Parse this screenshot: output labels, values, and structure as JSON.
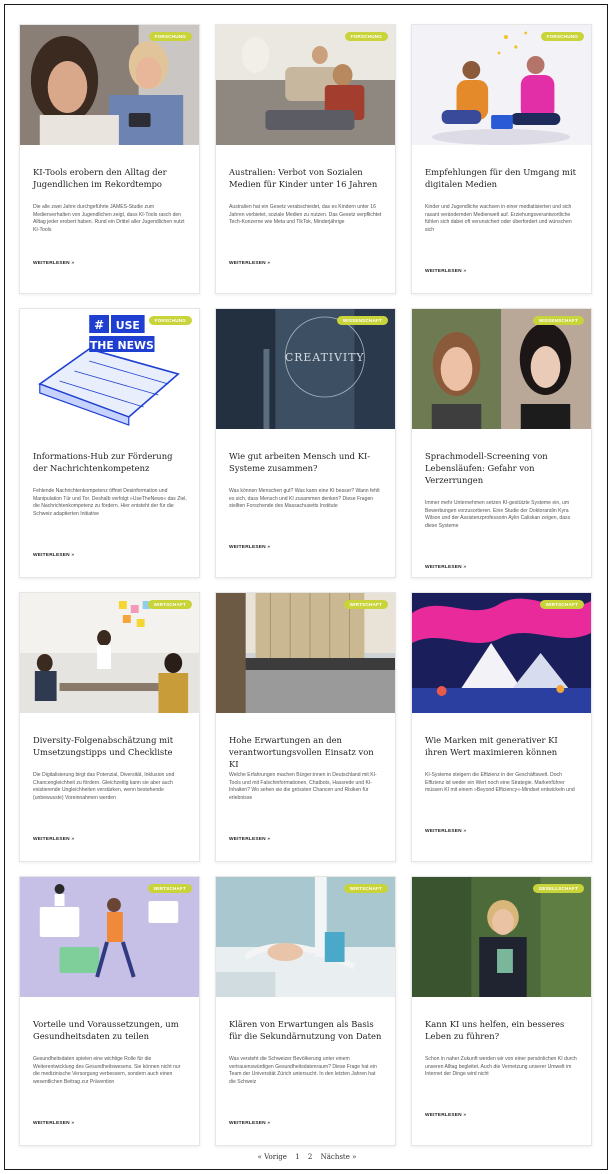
{
  "cards": [
    {
      "badge": "Forschung",
      "title": "KI-Tools erobern den Alltag der Jugendlichen im Rekordtempo",
      "excerpt": "Die alle zwei Jahre durchgeführte JAMES-Studie zum Medienverhalten von Jugendlichen zeigt, dass KI-Tools rasch den Alltag jeder erobert haben. Rund ein Drittel aller Jugendlichen nutzt KI-Tools",
      "more": "WEITERLESEN »"
    },
    {
      "badge": "Forschung",
      "title": "Australien: Verbot von Sozialen Medien für Kinder unter 16 Jahren",
      "excerpt": "Australien hat ein Gesetz verabschiedet, das es Kindern unter 16 Jahren verbietet, soziale Medien zu nutzen. Das Gesetz verpflichtet Tech-Konzerne wie Meta und TikTok, Minderjährige",
      "more": "WEITERLESEN »"
    },
    {
      "badge": "Forschung",
      "title": "Empfehlungen für den Umgang mit digitalen Medien",
      "excerpt": "Kinder und Jugendliche wachsen in einer mediatisierten und sich rasant verändernden Medienwelt auf. Erziehungsverantwortliche fühlen sich dabei oft verunsichert oder überfordert und wünschen sich",
      "more": "WEITERLESEN »"
    },
    {
      "badge": "Forschung",
      "title": "Informations-Hub zur Förderung der Nachrichtenkompetenz",
      "excerpt": "Fehlende Nachrichtenkompetenz öffnet Desinformation und Manipulation Tür und Tor. Deshalb verfolgt »UseTheNews« das Ziel, die Nachrichtenkompetenz zu fördern. Hier entsteht der für die Schweiz adaptierten Initiative",
      "more": "WEITERLESEN »"
    },
    {
      "badge": "Wissenschaft",
      "title": "Wie gut arbeiten Mensch und KI-Systeme zusammen?",
      "excerpt": "Was können Menschen gut? Was kann eine KI besser? Wann fehlt es sich, dass Mensch und KI zusammen denken? Diese Fragen stellten Forschende des Massachusetts Institute",
      "more": "WEITERLESEN »"
    },
    {
      "badge": "Wissenschaft",
      "title": "Sprachmodell-Screening von Lebensläufen: Gefahr von Verzerrungen",
      "excerpt": "Immer mehr Unternehmen setzen KI-gestützte Systeme ein, um Bewerbungen vorzusortieren. Eine Studie der Doktorandin Kyra Wilson und der Assistenzprofessorin Aylin Caliskan zeigen, dass diese Systeme",
      "more": "WEITERLESEN »"
    },
    {
      "badge": "Wirtschaft",
      "title": "Diversity-Folgenabschätzung mit Umsetzungstipps und Checkliste",
      "excerpt": "Die Digitalisierung birgt das Potenzial, Diversität, Inklusion und Chancengleichheit zu fördern. Gleichzeitig kann sie aber auch existierende Ungleichheiten verstärken, wenn bestehende (unbewusste) Voreinnahmen werden",
      "more": "WEITERLESEN »"
    },
    {
      "badge": "Wirtschaft",
      "title": "Hohe Erwartungen an den verantwortungsvollen Einsatz von KI",
      "excerpt": "Welche Erfahrungen machen Bürger:innen in Deutschland mit KI-Tools und mit Falschinformationen, Chatbots, Hassrede und KI-Inhalten? Wo sehen sie die grössten Chancen und Risiken für erlebnisse",
      "more": "WEITERLESEN »"
    },
    {
      "badge": "Wirtschaft",
      "title": "Wie Marken mit generativer KI ihren Wert maximieren können",
      "excerpt": "KI-Systeme steigern die Effizienz in der Geschäftswelt. Doch Effizienz ist weder ein Wert noch eine Strategie. Markenführer müssen KI mit einem »Beyond Efficiency«-Mindset entwickeln und",
      "more": "WEITERLESEN »"
    },
    {
      "badge": "Wirtschaft",
      "title": "Vorteile und Voraussetzungen, um Gesundheitsdaten zu teilen",
      "excerpt": "Gesundheitsdaten spielen eine wichtige Rolle für die Weiterentwicklung des Gesundheitswesens. Sie können nicht nur die medizinische Versorgung verbessern, sondern auch einen wesentlichen Beitrag zur Prävention",
      "more": "WEITERLESEN »"
    },
    {
      "badge": "Wirtschaft",
      "title": "Klären von Erwartungen als Basis für die Sekundärnutzung von Daten",
      "excerpt": "Was versteht die Schweizer Bevölkerung unter einem vertrauenswürdigen Gesundheitsdatenraum? Diese Frage hat ein Team der Universität Zürich untersucht. In den letzten Jahren hat die Schweiz",
      "more": "WEITERLESEN »"
    },
    {
      "badge": "Gesellschaft",
      "title": "Kann KI uns helfen, ein besseres Leben zu führen?",
      "excerpt": "Schon in naher Zukunft werden wir von einer persönlichen KI durch unseren Alltag begleitet. Auch die Vernetzung unserer Umwelt im Internet der Dinge wird nicht",
      "more": "WEITERLESEN »"
    }
  ],
  "images": {
    "mural_text": "CREATIVITY",
    "news_text": [
      "#",
      "USE",
      "THE NEWS"
    ]
  },
  "pagination": {
    "prev": "« Vorige",
    "page1": "1",
    "page2": "2",
    "next": "Nächste »"
  },
  "colors": {
    "badge": "#c8d43a",
    "newsblue": "#1e3fd0"
  }
}
